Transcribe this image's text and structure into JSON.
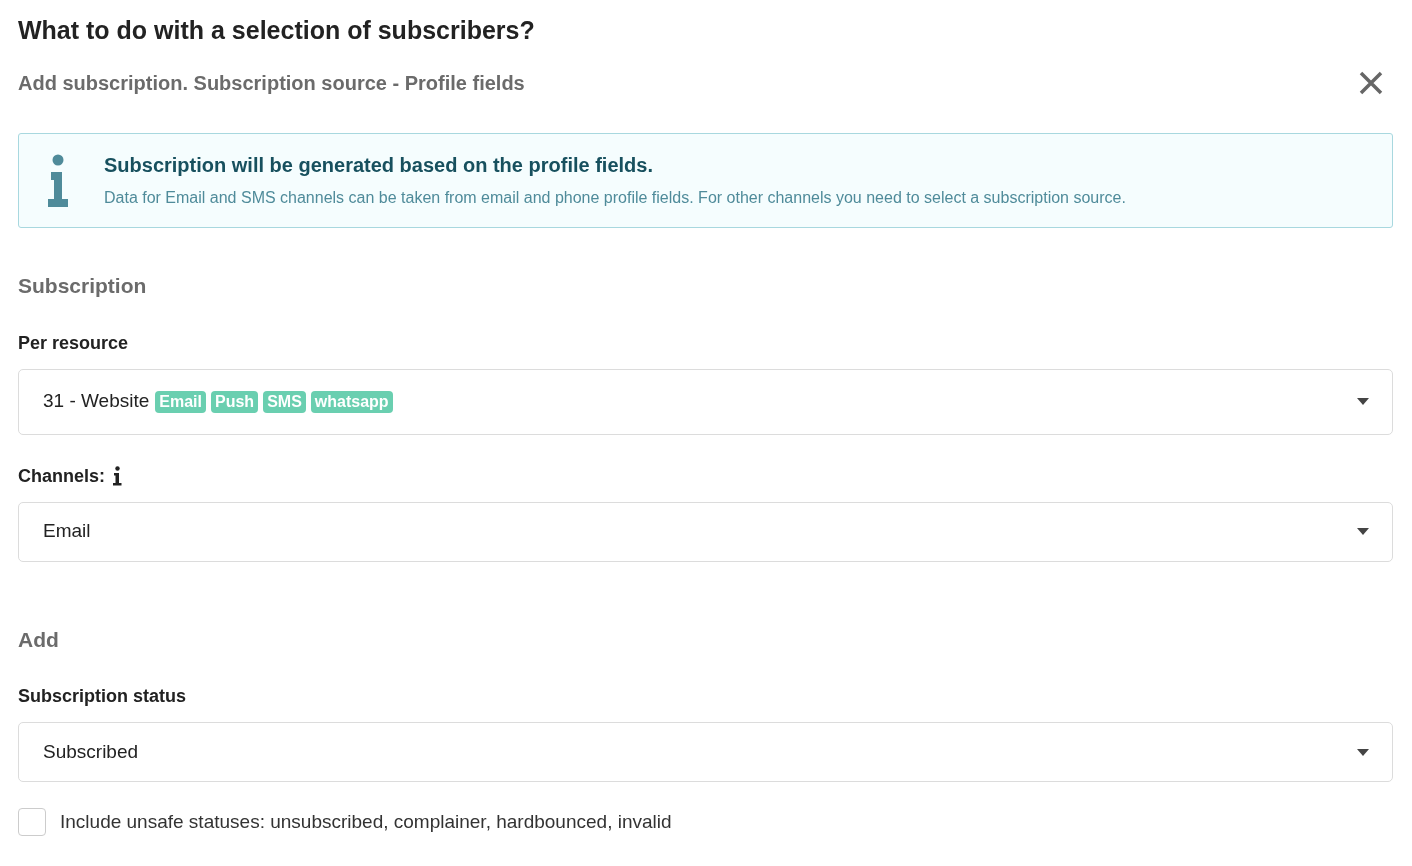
{
  "title": "What to do with a selection of subscribers?",
  "subtitle": "Add subscription. Subscription source - Profile fields",
  "info": {
    "heading": "Subscription will be generated based on the profile fields.",
    "text": "Data for Email and SMS channels can be taken from email and phone profile fields. For other channels you need to select a subscription source."
  },
  "sections": [
    {
      "heading": "Subscription",
      "fields": [
        {
          "label": "Per resource",
          "label_info": false,
          "value": "31 - Website",
          "tags": [
            "Email",
            "Push",
            "SMS",
            "whatsapp"
          ]
        },
        {
          "label": "Channels:",
          "label_info": true,
          "value": "Email"
        }
      ]
    },
    {
      "heading": "Add",
      "fields": [
        {
          "label": "Subscription status",
          "label_info": false,
          "value": "Subscribed"
        }
      ]
    }
  ],
  "checkbox": {
    "label": "Include unsafe statuses: unsubscribed, complainer, hardbounced, invalid",
    "checked": false
  }
}
